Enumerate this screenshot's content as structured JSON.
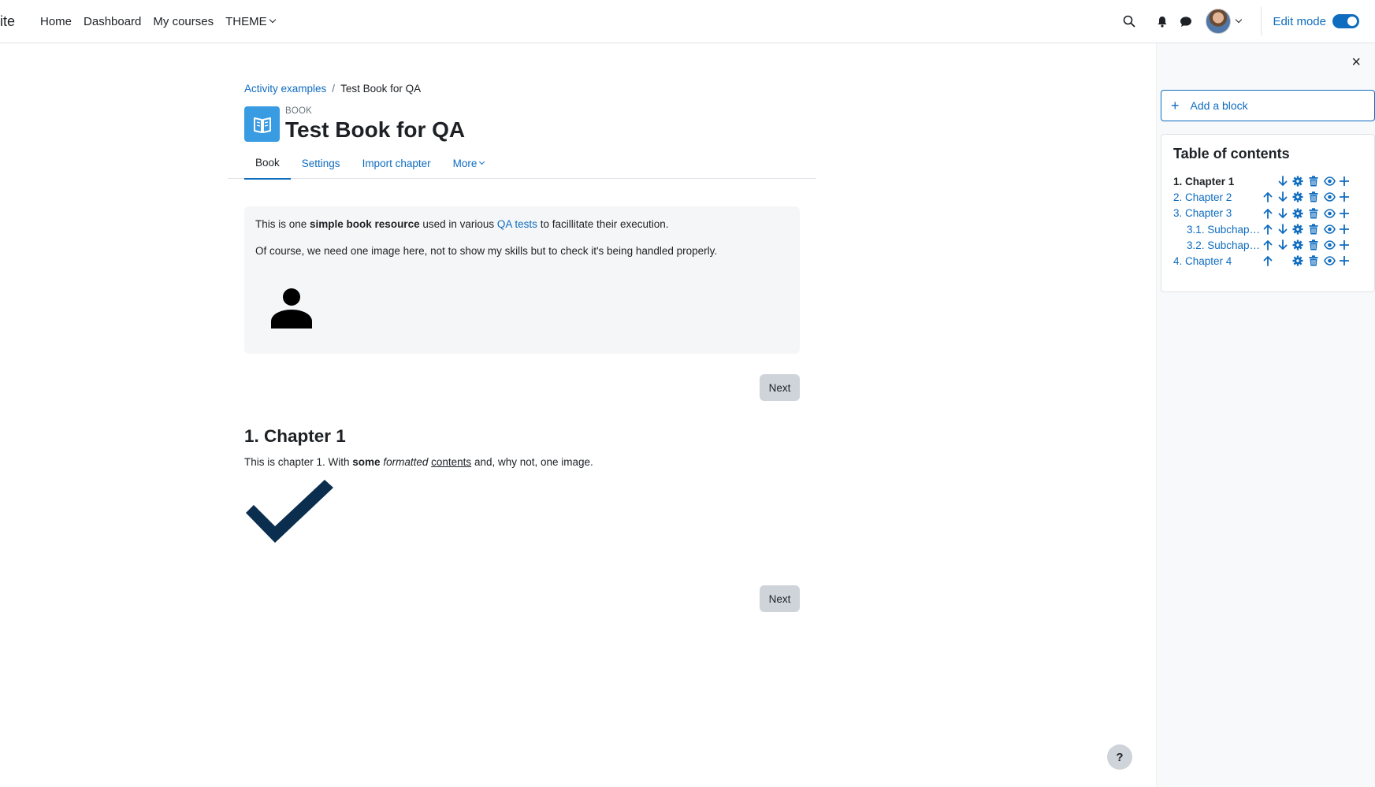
{
  "navbar": {
    "brand": "ite",
    "links": [
      "Home",
      "Dashboard",
      "My courses",
      "THEME"
    ],
    "edit_mode_label": "Edit mode"
  },
  "breadcrumb": {
    "parent": "Activity examples",
    "separator": "/",
    "current": "Test Book for QA"
  },
  "activity": {
    "type_label": "BOOK",
    "title": "Test Book for QA"
  },
  "tabs": [
    "Book",
    "Settings",
    "Import chapter",
    "More"
  ],
  "intro": {
    "p1_before": "This is one ",
    "p1_bold": "simple book resource",
    "p1_mid": " used in various ",
    "p1_link": "QA tests",
    "p1_after": " to facillitate their execution.",
    "p2": "Of course, we need one image here, not to show my skills but to check it's being handled properly."
  },
  "buttons": {
    "next": "Next"
  },
  "chapter": {
    "title": "1. Chapter 1",
    "text_before": "This is chapter 1. With ",
    "text_bold": "some",
    "text_space1": " ",
    "text_italic": "formatted",
    "text_space2": " ",
    "text_underline": "contents",
    "text_after": " and, why not, one image."
  },
  "drawer": {
    "close": "×",
    "add_block": "Add a block",
    "toc_title": "Table of contents",
    "toc": [
      {
        "label": "1. Chapter 1",
        "active": true,
        "sub": false,
        "up": false
      },
      {
        "label": "2. Chapter 2",
        "active": false,
        "sub": false,
        "up": true
      },
      {
        "label": "3. Chapter 3",
        "active": false,
        "sub": false,
        "up": true
      },
      {
        "label": "3.1. Subchap…",
        "active": false,
        "sub": true,
        "up": true
      },
      {
        "label": "3.2. Subchap…",
        "active": false,
        "sub": true,
        "up": true
      },
      {
        "label": "4. Chapter 4",
        "active": false,
        "sub": false,
        "up": true,
        "down": false
      }
    ]
  },
  "help_label": "?",
  "colors": {
    "accent": "#0f6cbf",
    "book_icon_bg": "#399be2",
    "check_color": "#0b2d4e"
  }
}
